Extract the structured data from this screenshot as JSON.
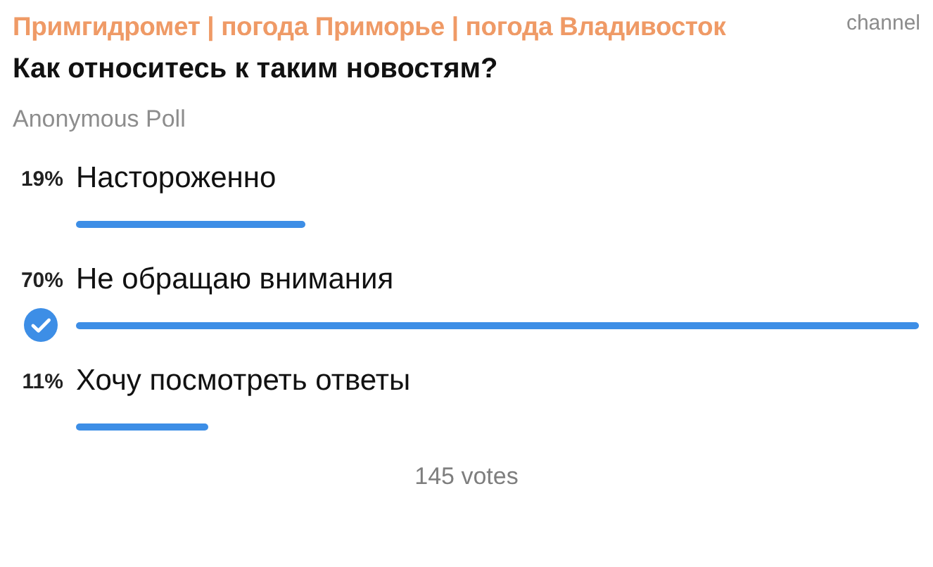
{
  "channel": {
    "name": "Примгидромет | погода Приморье | погода Владивосток",
    "badge": "channel"
  },
  "poll": {
    "question": "Как относитесь к таким новостям?",
    "type": "Anonymous Poll",
    "options": [
      {
        "percent": "19%",
        "label": "Настороженно",
        "selected": false
      },
      {
        "percent": "70%",
        "label": "Не обращаю внимания",
        "selected": true
      },
      {
        "percent": "11%",
        "label": "Хочу посмотреть ответы",
        "selected": false
      }
    ],
    "votes": "145 votes"
  }
}
